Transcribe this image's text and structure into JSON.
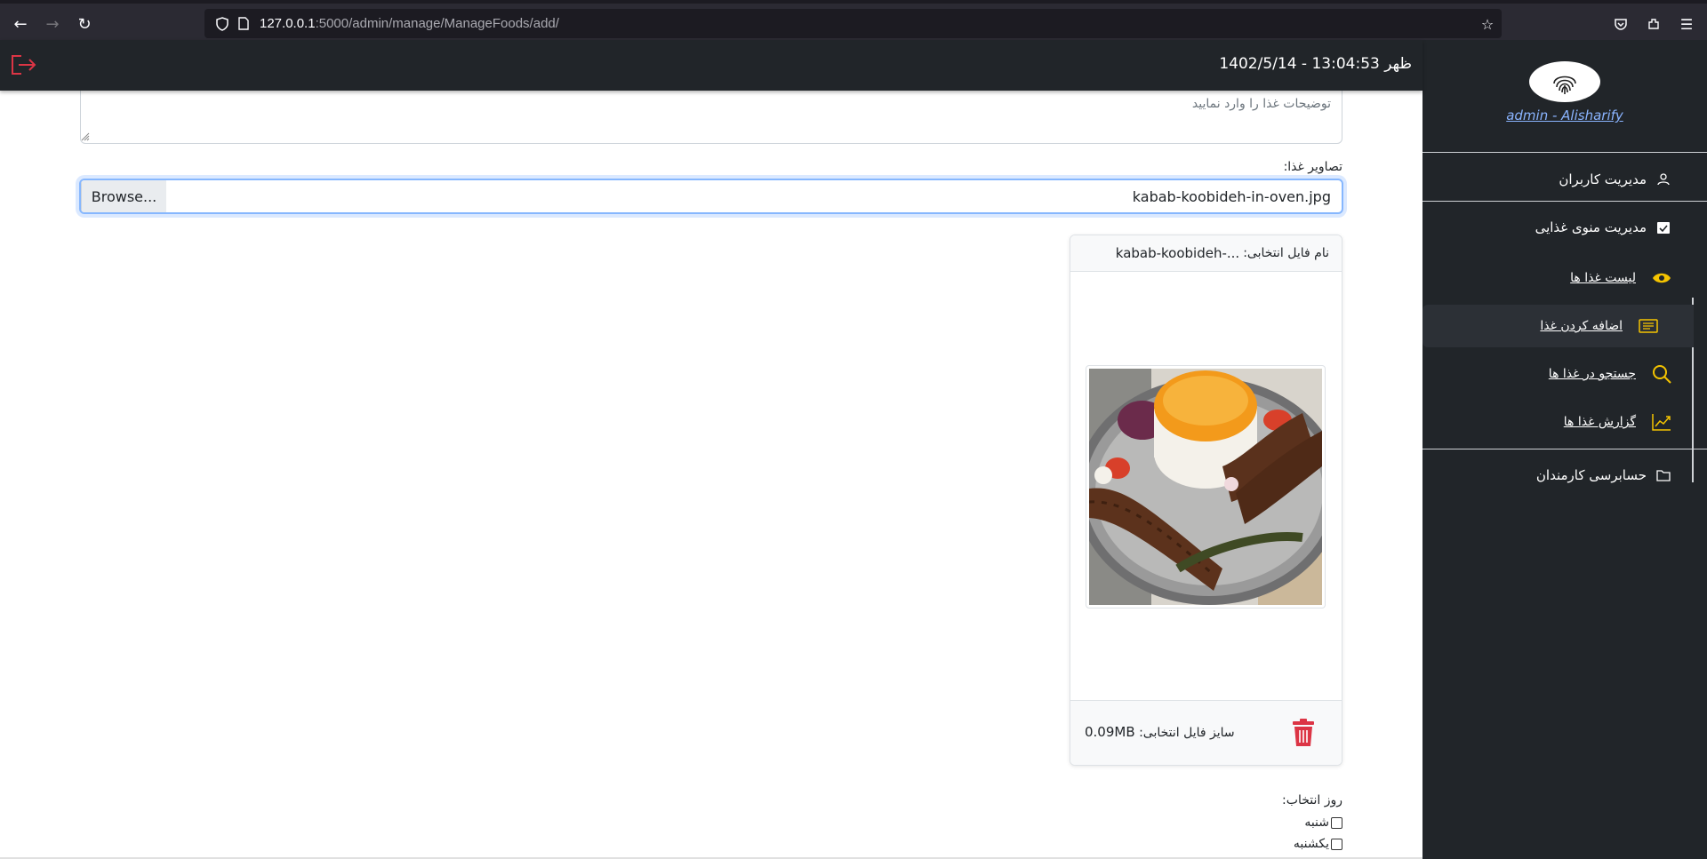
{
  "browser": {
    "url_host": "127.0.0.1",
    "url_path": ":5000/admin/manage/ManageFoods/add/"
  },
  "header": {
    "clock": "ظهر 13:04:53 - 1402/5/14"
  },
  "sidebar": {
    "user": "admin - Alisharify",
    "items": [
      {
        "label": "مدیریت کاربران",
        "icon": "user-icon"
      },
      {
        "label": "مدیریت منوی غذایی",
        "icon": "calendar-check-icon"
      },
      {
        "label": "حسابرسی کارمندان",
        "icon": "folder-icon"
      }
    ],
    "sub_items": [
      {
        "label": "لیست غذا ها",
        "icon": "eye-icon"
      },
      {
        "label": "اضافه کردن غذا",
        "icon": "list-card-icon"
      },
      {
        "label": "جستجو در غذا ها",
        "icon": "search-icon"
      },
      {
        "label": "گزارش غذا ها",
        "icon": "chart-icon"
      }
    ],
    "accent_color": "#f5c400"
  },
  "form": {
    "description_placeholder": "توضیحات غذا را وارد نمایید",
    "images_label": "تصاویر غذا:",
    "file_button": "Browse...",
    "file_name": "kabab-koobideh-in-oven.jpg",
    "preview": {
      "name_label": "نام فایل انتخابی:",
      "name_value": "kabab-koobideh-...",
      "size_label": "سایز فایل انتخابی:",
      "size_value": "0.09MB"
    },
    "days_label": "روز انتخاب:",
    "days": [
      "شنبه",
      "یکشنبه"
    ]
  }
}
